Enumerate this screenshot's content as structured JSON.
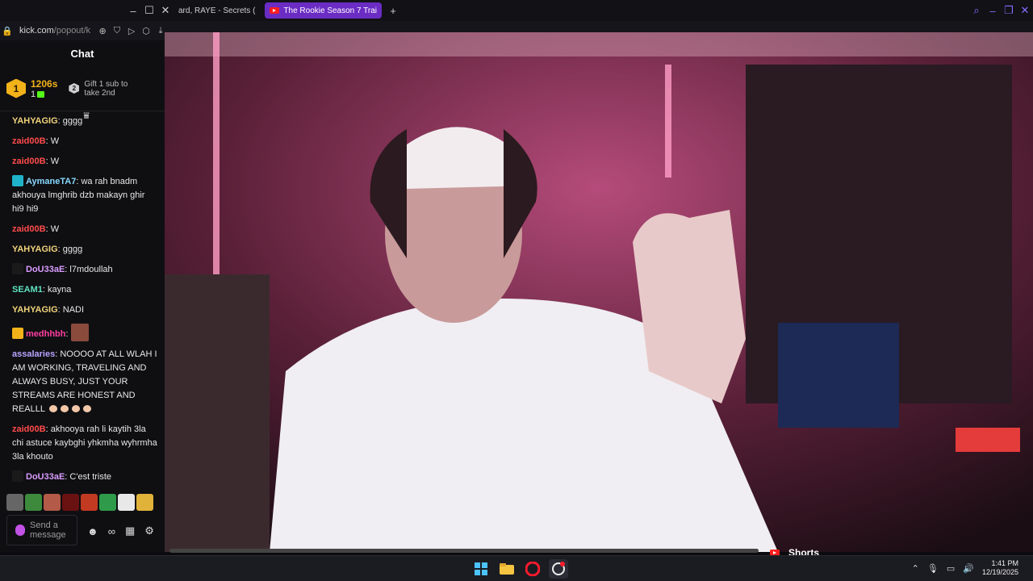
{
  "browser": {
    "tabs": [
      {
        "title": "ard, RAYE - Secrets (",
        "active": false
      },
      {
        "title": "The Rookie Season 7 Trai",
        "active": true
      }
    ],
    "new_tab": "+",
    "url_host": "kick.com",
    "url_path": "/popout/k"
  },
  "chat": {
    "title": "Chat",
    "leaderboard": {
      "rank": "1",
      "gift_count": "1206s",
      "sub_count": "1",
      "next_rank": "2",
      "gift_prompt": "Gift 1 sub to take 2nd"
    },
    "messages": [
      {
        "user": "YAHYAGIG",
        "color": "u-yellow",
        "text": "gggg"
      },
      {
        "user": "zaid00B",
        "color": "u-red",
        "text": "W"
      },
      {
        "user": "zaid00B",
        "color": "u-red",
        "text": "W"
      },
      {
        "user": "AymaneTA7",
        "color": "u-cyan",
        "text": "wa rah bnadm akhouya lmghrib dzb makayn ghir hi9 hi9"
      },
      {
        "user": "zaid00B",
        "color": "u-red",
        "text": "W"
      },
      {
        "user": "YAHYAGIG",
        "color": "u-yellow",
        "text": "gggg"
      },
      {
        "user": "DoU33aE",
        "color": "u-purple",
        "text": "l7mdoullah"
      },
      {
        "user": "SEAM1",
        "color": "u-teal",
        "text": "kayna"
      },
      {
        "user": "YAHYAGIG",
        "color": "u-yellow",
        "text": "NADI"
      },
      {
        "user": "medhhbh",
        "color": "u-pink",
        "text": ""
      },
      {
        "user": "assalaries",
        "color": "u-lav",
        "text": "NOOOO AT ALL WLAH I AM WORKING, TRAVELING AND ALWAYS BUSY, JUST YOUR STREAMS ARE HONEST AND REALLL"
      },
      {
        "user": "zaid00B",
        "color": "u-red",
        "text": "akhooya rah li kaytih 3la chi astuce kaybghi yhkmha wyhrmha 3la khouto"
      },
      {
        "user": "DoU33aE",
        "color": "u-purple",
        "text": "C'est triste"
      }
    ],
    "input_placeholder": "Send a message"
  },
  "video": {
    "related_label": "Shorts"
  },
  "taskbar": {
    "time": "1:41 PM",
    "date": "12/19/2025"
  }
}
